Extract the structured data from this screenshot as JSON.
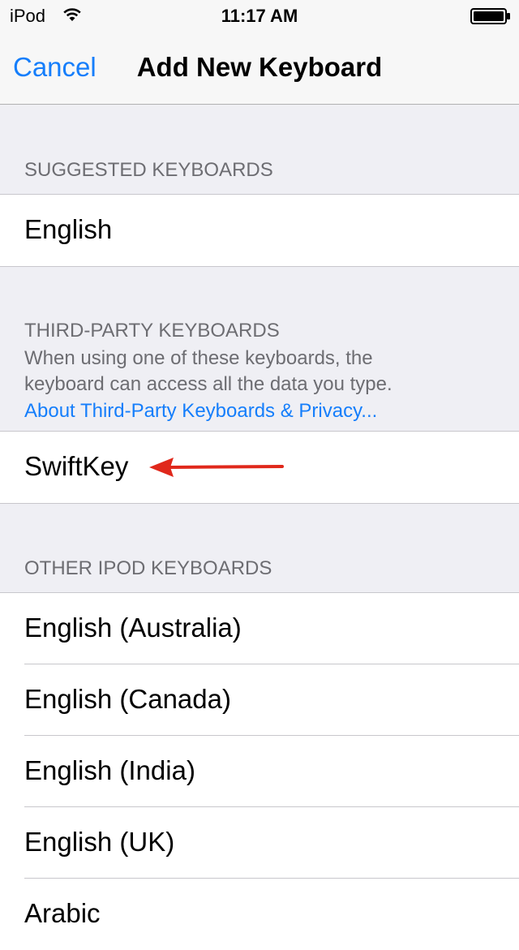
{
  "status_bar": {
    "carrier": "iPod",
    "time": "11:17 AM"
  },
  "nav": {
    "cancel_label": "Cancel",
    "title": "Add New Keyboard"
  },
  "suggested": {
    "header": "SUGGESTED KEYBOARDS",
    "items": [
      "English"
    ]
  },
  "third_party": {
    "header": "THIRD-PARTY KEYBOARDS",
    "note_line1": "When using one of these keyboards, the",
    "note_line2": "keyboard can access all the data you type.",
    "link": "About Third-Party Keyboards & Privacy...",
    "items": [
      "SwiftKey"
    ]
  },
  "other": {
    "header": "OTHER IPOD KEYBOARDS",
    "items": [
      "English (Australia)",
      "English (Canada)",
      "English (India)",
      "English (UK)",
      "Arabic"
    ]
  },
  "colors": {
    "accent": "#157efb",
    "arrow": "#e0281b",
    "background": "#efeff4"
  },
  "icons": [
    "wifi-icon",
    "battery-icon",
    "red-arrow-annotation"
  ]
}
